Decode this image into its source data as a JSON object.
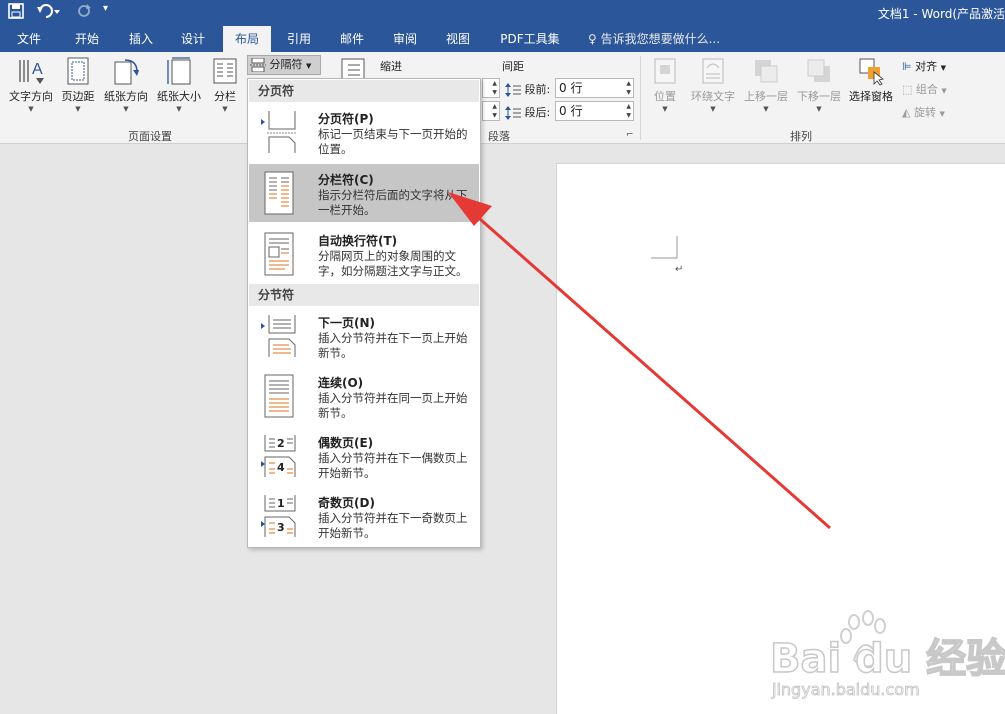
{
  "titlebar": {
    "title": "文档1 - Word(产品激活",
    "save_icon": "save-icon",
    "undo_icon": "undo-icon",
    "redo_icon": "redo-icon"
  },
  "tabs": [
    {
      "label": "文件"
    },
    {
      "label": "开始"
    },
    {
      "label": "插入"
    },
    {
      "label": "设计"
    },
    {
      "label": "布局",
      "active": true
    },
    {
      "label": "引用"
    },
    {
      "label": "邮件"
    },
    {
      "label": "审阅"
    },
    {
      "label": "视图"
    },
    {
      "label": "PDF工具集"
    }
  ],
  "tellme": "♀ 告诉我您想要做什么...",
  "page_setup": {
    "buttons": [
      "文字方向",
      "页边距",
      "纸张方向",
      "纸张大小",
      "分栏"
    ],
    "breaks_label": "分隔符",
    "group_label": "页面设置"
  },
  "paragraph": {
    "indent_label": "缩进",
    "spacing_label": "间距",
    "before_label": "段前:",
    "after_label": "段后:",
    "before_value": "0 行",
    "after_value": "0 行",
    "group_label": "段落"
  },
  "arrange": {
    "buttons": [
      "位置",
      "环绕文字",
      "上移一层",
      "下移一层",
      "选择窗格"
    ],
    "align_label": "对齐",
    "group_label": "组合",
    "rotate_label": "旋转",
    "section_label": "排列"
  },
  "dropdown": {
    "page_breaks_header": "分页符",
    "section_breaks_header": "分节符",
    "items": [
      {
        "title": "分页符(P)",
        "desc": "标记一页结束与下一页开始的位置。"
      },
      {
        "title": "分栏符(C)",
        "desc": "指示分栏符后面的文字将从下一栏开始。"
      },
      {
        "title": "自动换行符(T)",
        "desc": "分隔网页上的对象周围的文字，如分隔题注文字与正文。"
      },
      {
        "title": "下一页(N)",
        "desc": "插入分节符并在下一页上开始新节。"
      },
      {
        "title": "连续(O)",
        "desc": "插入分节符并在同一页上开始新节。"
      },
      {
        "title": "偶数页(E)",
        "desc": "插入分节符并在下一偶数页上开始新节。"
      },
      {
        "title": "奇数页(D)",
        "desc": "插入分节符并在下一奇数页上开始新节。"
      }
    ]
  },
  "document": {
    "paragraph_mark": "↵"
  },
  "watermark": {
    "brand": "Bai du 经验",
    "url": "jingyan.baidu.com"
  },
  "colors": {
    "ribbon_blue": "#2b579a",
    "arrow_red": "#e53935",
    "hover_gray": "#c6c6c6",
    "icon_orange": "#e0701f"
  }
}
